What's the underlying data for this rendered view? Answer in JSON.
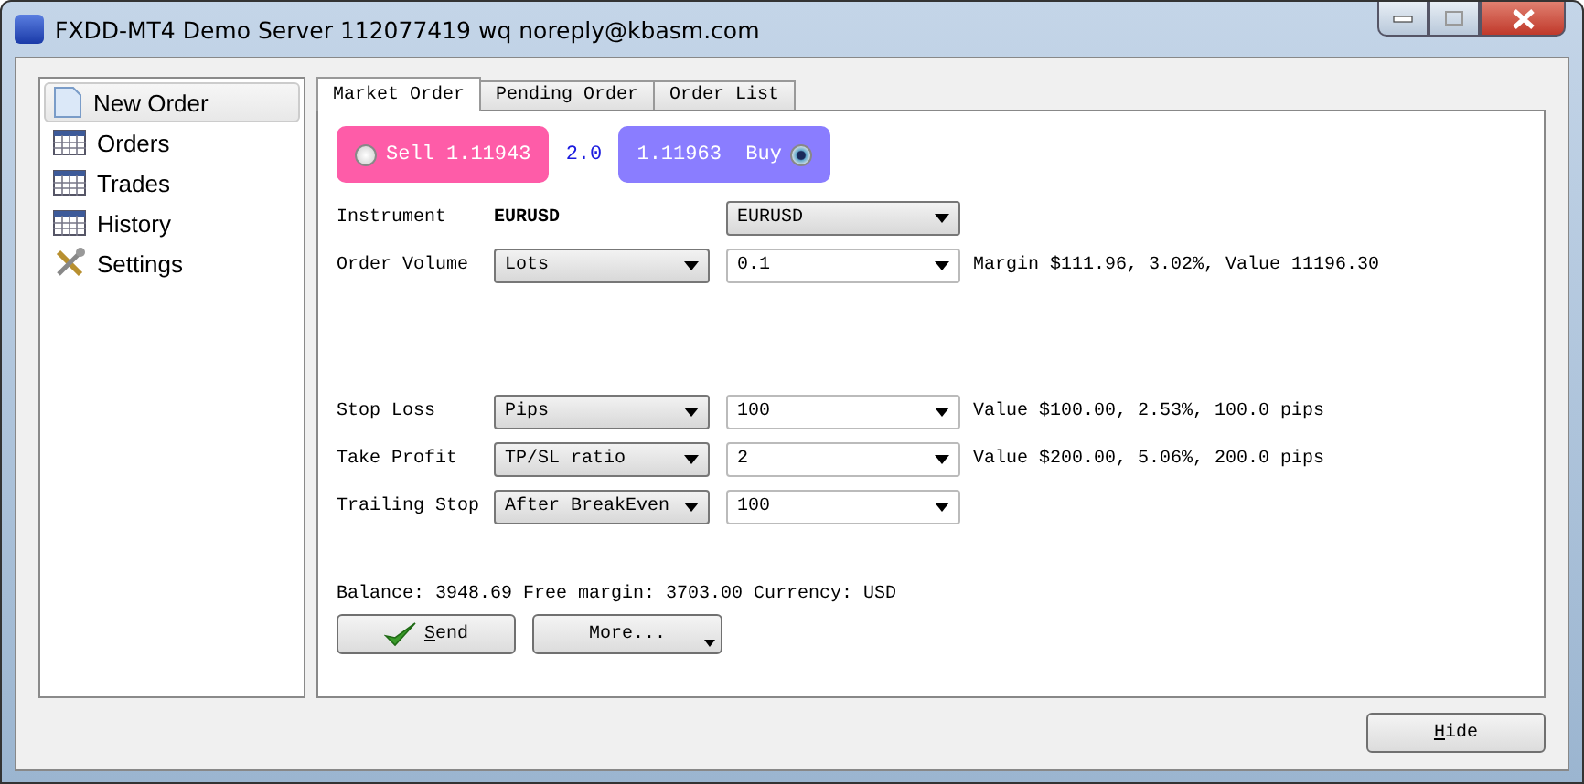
{
  "window": {
    "title": "FXDD-MT4 Demo Server 112077419 wq noreply@kbasm.com"
  },
  "sidebar": {
    "items": [
      {
        "label": "New Order",
        "kind": "page",
        "selected": true
      },
      {
        "label": "Orders",
        "kind": "grid",
        "selected": false
      },
      {
        "label": "Trades",
        "kind": "grid",
        "selected": false
      },
      {
        "label": "History",
        "kind": "grid",
        "selected": false
      },
      {
        "label": "Settings",
        "kind": "tools",
        "selected": false
      }
    ]
  },
  "tabs": [
    {
      "label": "Market Order",
      "selected": true
    },
    {
      "label": "Pending Order",
      "selected": false
    },
    {
      "label": "Order List",
      "selected": false
    }
  ],
  "quote": {
    "sell": {
      "label": "Sell 1.11943",
      "selected": false
    },
    "spread": "2.0",
    "buy": {
      "label": "1.11963  Buy",
      "selected": true
    }
  },
  "rows": [
    {
      "kind": "static",
      "label": "Instrument",
      "value": "EURUSD",
      "select": "EURUSD"
    },
    {
      "kind": "pair",
      "label": "Order Volume",
      "mode": "Lots",
      "value": "0.1",
      "info": "Margin $111.96, 3.02%, Value 11196.30"
    },
    {
      "kind": "spacer"
    },
    {
      "kind": "pair",
      "label": "Stop Loss",
      "mode": "Pips",
      "value": "100",
      "info": "Value $100.00, 2.53%, 100.0 pips"
    },
    {
      "kind": "pair",
      "label": "Take Profit",
      "mode": "TP/SL ratio",
      "value": "2",
      "info": "Value $200.00, 5.06%, 200.0 pips"
    },
    {
      "kind": "pair",
      "label": "Trailing Stop",
      "mode": "After BreakEven",
      "value": "100"
    }
  ],
  "balance": "Balance: 3948.69 Free margin: 3703.00 Currency: USD",
  "buttons": {
    "send": "Send",
    "more": "More...",
    "hide": "Hide"
  }
}
